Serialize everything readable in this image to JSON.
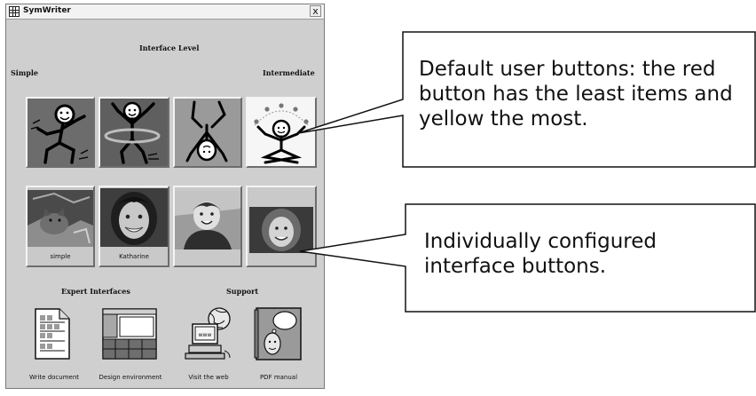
{
  "window": {
    "title": "SymWriter",
    "close_label": "x"
  },
  "sections": {
    "interface_level": "Interface Level",
    "simple": "Simple",
    "intermediate": "Intermediate",
    "expert_interfaces": "Expert Interfaces",
    "support": "Support"
  },
  "user_buttons": {
    "row1": [
      {
        "name": "red"
      },
      {
        "name": "green"
      },
      {
        "name": "blue"
      },
      {
        "name": "yellow"
      }
    ],
    "row2": [
      {
        "caption": "simple"
      },
      {
        "caption": "Katharine"
      },
      {
        "caption": ""
      },
      {
        "caption": ""
      }
    ]
  },
  "expert": {
    "write_document": "Write document",
    "design_environment": "Design environment"
  },
  "support_items": {
    "visit_web": "Visit the web",
    "www_text": "www",
    "pdf_manual": "PDF manual"
  },
  "callouts": {
    "default_users": "Default user buttons: the red button has the least items and yellow the most.",
    "individual": "Individually configured interface buttons."
  }
}
